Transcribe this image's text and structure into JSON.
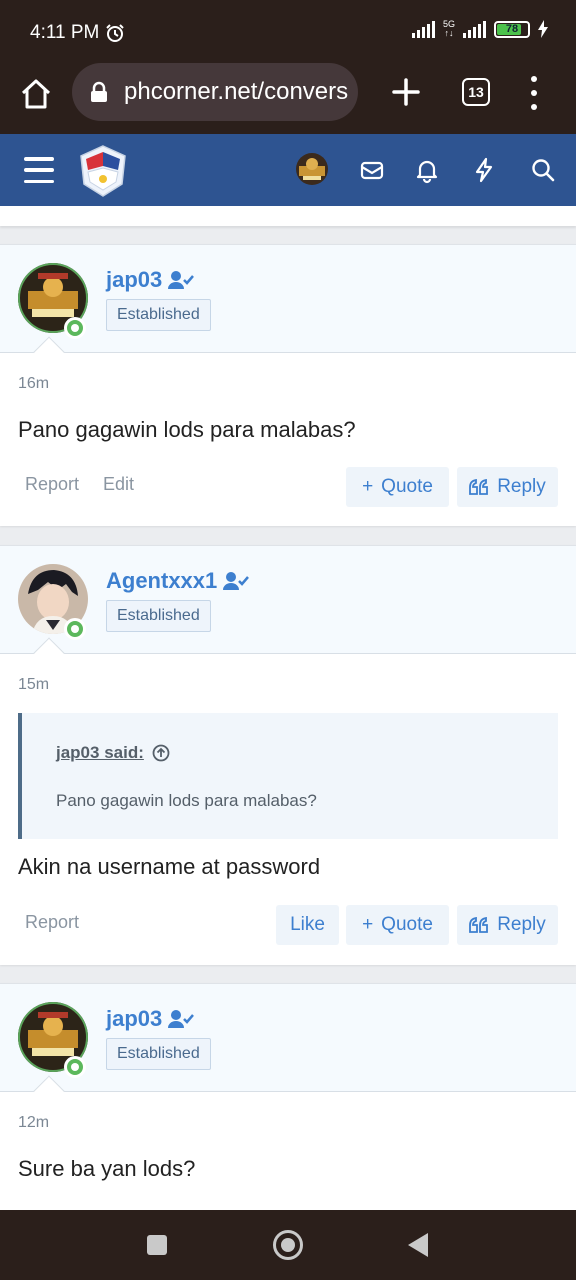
{
  "status": {
    "time": "4:11 PM",
    "network": "5G",
    "battery": "78"
  },
  "browser": {
    "url": "phcorner.net/convers",
    "tab_count": "13"
  },
  "header": {
    "brand_color": "#2e5491"
  },
  "posts": [
    {
      "username": "jap03",
      "badge": "Established",
      "time": "16m",
      "message": "Pano gagawin lods para malabas?",
      "actions_left": [
        "Report",
        "Edit"
      ],
      "quote_label": "Quote",
      "reply_label": "Reply"
    },
    {
      "username": "Agentxxx1",
      "badge": "Established",
      "time": "15m",
      "quote_author": "jap03 said:",
      "quote_text": "Pano gagawin lods para malabas?",
      "message": "Akin na username at password",
      "actions_left": [
        "Report"
      ],
      "like_label": "Like",
      "quote_label": "Quote",
      "reply_label": "Reply"
    },
    {
      "username": "jap03",
      "badge": "Established",
      "time": "12m",
      "message": "Sure ba yan lods?"
    }
  ]
}
